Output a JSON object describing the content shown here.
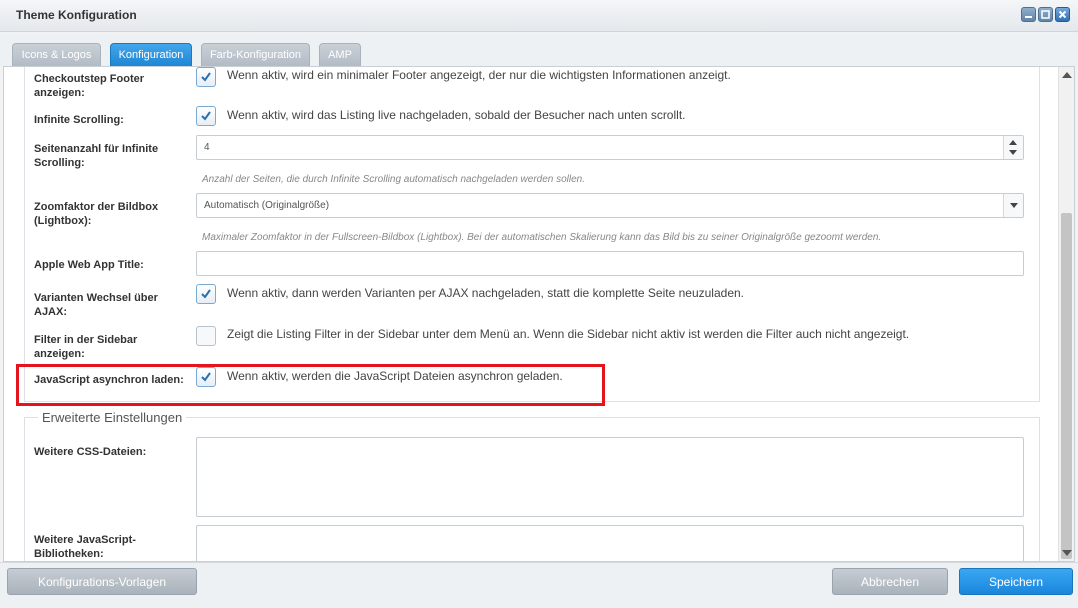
{
  "window": {
    "title": "Theme Konfiguration"
  },
  "tabs": [
    {
      "label": "Icons & Logos",
      "active": false
    },
    {
      "label": "Konfiguration",
      "active": true
    },
    {
      "label": "Farb-Konfiguration",
      "active": false
    },
    {
      "label": "AMP",
      "active": false
    }
  ],
  "fields": {
    "checkoutstep_footer": {
      "label": "Checkoutstep Footer anzeigen:",
      "checked": true,
      "description": "Wenn aktiv, wird ein minimaler Footer angezeigt, der nur die wichtigsten Informationen anzeigt."
    },
    "infinite_scrolling": {
      "label": "Infinite Scrolling:",
      "checked": true,
      "description": "Wenn aktiv, wird das Listing live nachgeladen, sobald der Besucher nach unten scrollt."
    },
    "seitenanzahl": {
      "label": "Seitenanzahl für Infinite Scrolling:",
      "value": "4",
      "hint": "Anzahl der Seiten, die durch Infinite Scrolling automatisch nachgeladen werden sollen."
    },
    "zoomfaktor": {
      "label": "Zoomfaktor der Bildbox (Lightbox):",
      "value": "Automatisch (Originalgröße)",
      "hint": "Maximaler Zoomfaktor in der Fullscreen-Bildbox (Lightbox). Bei der automatischen Skalierung kann das Bild bis zu seiner Originalgröße gezoomt werden."
    },
    "apple_title": {
      "label": "Apple Web App Title:",
      "value": ""
    },
    "varianten_ajax": {
      "label": "Varianten Wechsel über AJAX:",
      "checked": true,
      "description": "Wenn aktiv, dann werden Varianten per AJAX nachgeladen, statt die komplette Seite neuzuladen."
    },
    "filter_sidebar": {
      "label": "Filter in der Sidebar anzeigen:",
      "checked": false,
      "description": "Zeigt die Listing Filter in der Sidebar unter dem Menü an. Wenn die Sidebar nicht aktiv ist werden die Filter auch nicht angezeigt."
    },
    "js_async": {
      "label": "JavaScript asynchron laden:",
      "checked": true,
      "description": "Wenn aktiv, werden die JavaScript Dateien asynchron geladen."
    }
  },
  "advanced": {
    "legend": "Erweiterte Einstellungen",
    "css_label": "Weitere CSS-Dateien:",
    "js_label": "Weitere JavaScript-Bibliotheken:"
  },
  "footer": {
    "templates_button": "Konfigurations-Vorlagen",
    "cancel_button": "Abbrechen",
    "save_button": "Speichern"
  },
  "colors": {
    "accent": "#1e86d4",
    "highlight": "#e3141b"
  }
}
